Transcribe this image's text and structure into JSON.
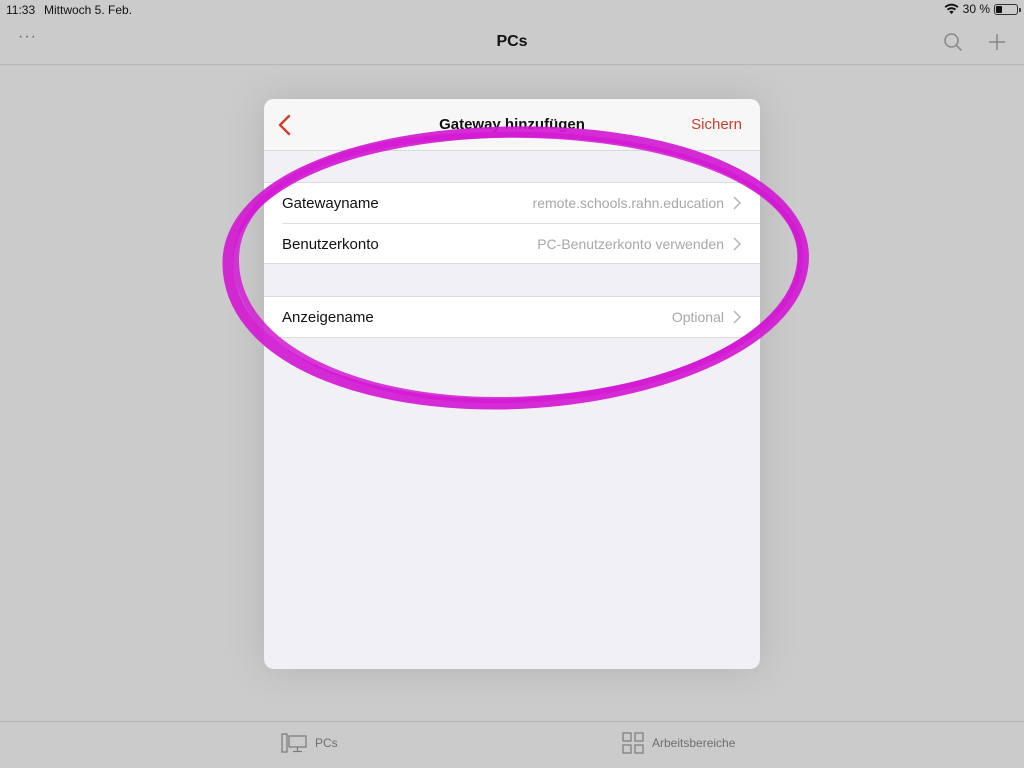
{
  "status_bar": {
    "time": "11:33",
    "date": "Mittwoch 5. Feb.",
    "battery": "30 %"
  },
  "nav_bar": {
    "title": "PCs",
    "more_label": "···",
    "icons": [
      "more-icon",
      "search-icon",
      "plus-icon"
    ]
  },
  "modal": {
    "title": "Gateway hinzufügen",
    "save_label": "Sichern",
    "back_icon": "chevron-left-icon",
    "groups": [
      {
        "rows": [
          {
            "label": "Gatewayname",
            "value": "remote.schools.rahn.education"
          },
          {
            "label": "Benutzerkonto",
            "value": "PC-Benutzerkonto verwenden"
          }
        ]
      },
      {
        "rows": [
          {
            "label": "Anzeigename",
            "value": "Optional"
          }
        ]
      }
    ]
  },
  "tab_bar": {
    "tabs": [
      {
        "label": "PCs",
        "icon": "desktop-pc-icon"
      },
      {
        "label": "Arbeitsbereiche",
        "icon": "grid-icon"
      }
    ]
  },
  "colors": {
    "accent": "#c9402b",
    "annotation": "#d21ad2",
    "background": "#cbcbcb"
  }
}
